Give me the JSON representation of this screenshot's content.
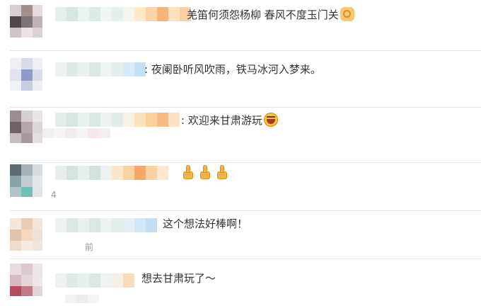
{
  "comments": [
    {
      "text": "羌笛何须怨杨柳 春风不度玉门关",
      "emoji_after": "ok-hand-icon"
    },
    {
      "text": ": 夜阑卧听风吹雨，铁马冰河入梦来。"
    },
    {
      "text": ": 欢迎来甘肃游玩",
      "emoji_after": "laughing-face-icon"
    },
    {
      "text": "",
      "emojis": [
        "thumbs-up-icon",
        "thumbs-up-icon",
        "thumbs-up-icon"
      ],
      "meta_fragment": "4"
    },
    {
      "text": "这个想法好棒啊！",
      "meta_fragment": "前"
    },
    {
      "text": "想去甘肃玩了～"
    }
  ]
}
